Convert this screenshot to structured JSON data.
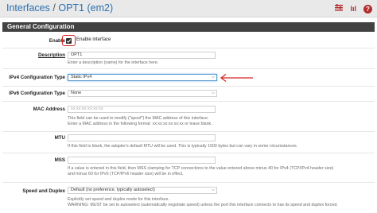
{
  "header": {
    "breadcrumb_root": "Interfaces",
    "breadcrumb_sep": "/",
    "breadcrumb_current": "OPT1 (em2)",
    "icons": [
      "status-bars-icon",
      "chart-icon",
      "help-icon"
    ],
    "icon_labels": [
      "lıl",
      "?"
    ]
  },
  "panel": {
    "title": "General Configuration"
  },
  "fields": {
    "enable": {
      "label": "Enable",
      "checkbox_label": "Enable interface",
      "checked": true
    },
    "description": {
      "label": "Description",
      "value": "OPT1",
      "help": "Enter a description (name) for the interface here."
    },
    "ipv4": {
      "label": "IPv4 Configuration Type",
      "value": "Static IPv4"
    },
    "ipv6": {
      "label": "IPv6 Configuration Type",
      "value": "None"
    },
    "mac": {
      "label": "MAC Address",
      "placeholder": "xx:xx:xx:xx:xx:xx",
      "help1": "This field can be used to modify (\"spoof\") the MAC address of this interface.",
      "help2": "Enter a MAC address in the following format: xx:xx:xx:xx:xx:xx or leave blank."
    },
    "mtu": {
      "label": "MTU",
      "help": "If this field is blank, the adapter's default MTU will be used. This is typically 1500 bytes but can vary in some circumstances."
    },
    "mss": {
      "label": "MSS",
      "help1": "If a value is entered in this field, then MSS clamping for TCP connections to the value entered above minus 40 for IPv4 (TCP/IPv4 header size)",
      "help2": "and minus 60 for IPv6 (TCP/IPv6 header size) will be in effect."
    },
    "speed": {
      "label": "Speed and Duplex",
      "value": "Default (no preference, typically autoselect)",
      "help1": "Explicitly set speed and duplex mode for this interface.",
      "help2": "WARNING: MUST be set to autoselect (automatically negotiate speed) unless the port this interface connects to has its speed and duplex forced."
    }
  },
  "colors": {
    "accent": "#d62424",
    "link": "#2a6fb0",
    "panel_header": "#424242"
  }
}
